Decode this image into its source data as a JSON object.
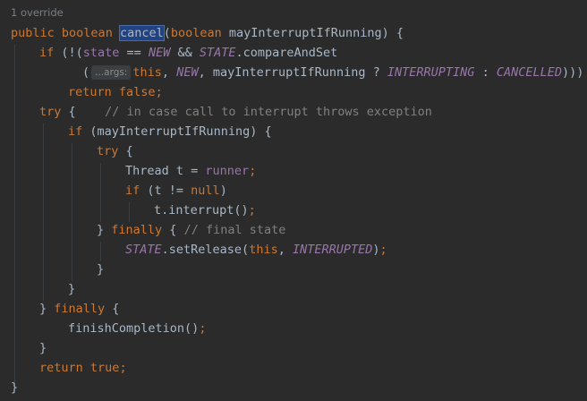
{
  "editor": {
    "usage_hint": "1 override",
    "lines": {
      "l1": {
        "kw_public": "public",
        "kw_boolean": "boolean",
        "method_name": "cancel",
        "open_paren": "(",
        "kw_boolean2": "boolean",
        "rest": " mayInterruptIfRunning) {"
      },
      "l2": {
        "kw_if": "if",
        "a": " (!(",
        "state": "state",
        "b": " == ",
        "new": "NEW",
        "c": " && ",
        "state_const": "STATE",
        "d": ".compareAndSet"
      },
      "l3": {
        "open": "(",
        "inlay": "...args:",
        "kw_this": "this",
        "comma1": ", ",
        "new": "NEW",
        "e": ", mayInterruptIfRunning ? ",
        "interrupting": "INTERRUPTING",
        "colon": " : ",
        "cancelled": "CANCELLED",
        "close": ")))"
      },
      "l4": {
        "kw_return": "return",
        "kw_false": "false",
        "semi": ";"
      },
      "l5": {
        "kw_try": "try",
        "brace": " {",
        "comment": "// in case call to interrupt throws exception"
      },
      "l6": {
        "kw_if": "if",
        "rest": " (mayInterruptIfRunning) {"
      },
      "l7": {
        "kw_try": "try",
        "brace": " {"
      },
      "l8": {
        "a": "Thread t = ",
        "runner": "runner",
        "semi": ";"
      },
      "l9": {
        "kw_if": "if",
        "a": " (t != ",
        "kw_null": "null",
        "b": ")"
      },
      "l10": {
        "a": "t.interrupt()",
        "semi": ";"
      },
      "l11": {
        "a": "} ",
        "kw_finally": "finally",
        "b": " { ",
        "comment": "// final state"
      },
      "l12": {
        "state_const": "STATE",
        "a": ".setRelease(",
        "kw_this": "this",
        "comma": ", ",
        "interrupted": "INTERRUPTED",
        "b": ")",
        "semi": ";"
      },
      "l13": {
        "a": "}"
      },
      "l14": {
        "a": "}"
      },
      "l15": {
        "a": "} ",
        "kw_finally": "finally",
        "b": " {"
      },
      "l16": {
        "a": "finishCompletion()",
        "semi": ";"
      },
      "l17": {
        "a": "}"
      },
      "l18": {
        "kw_return": "return",
        "kw_true": "true",
        "semi": ";"
      },
      "l19": {
        "a": "}"
      }
    },
    "colors": {
      "background": "#2b2b2b",
      "keyword": "#cc7832",
      "identifier": "#a9b7c6",
      "field": "#9876aa",
      "comment": "#808080",
      "selection": "#214283"
    }
  }
}
